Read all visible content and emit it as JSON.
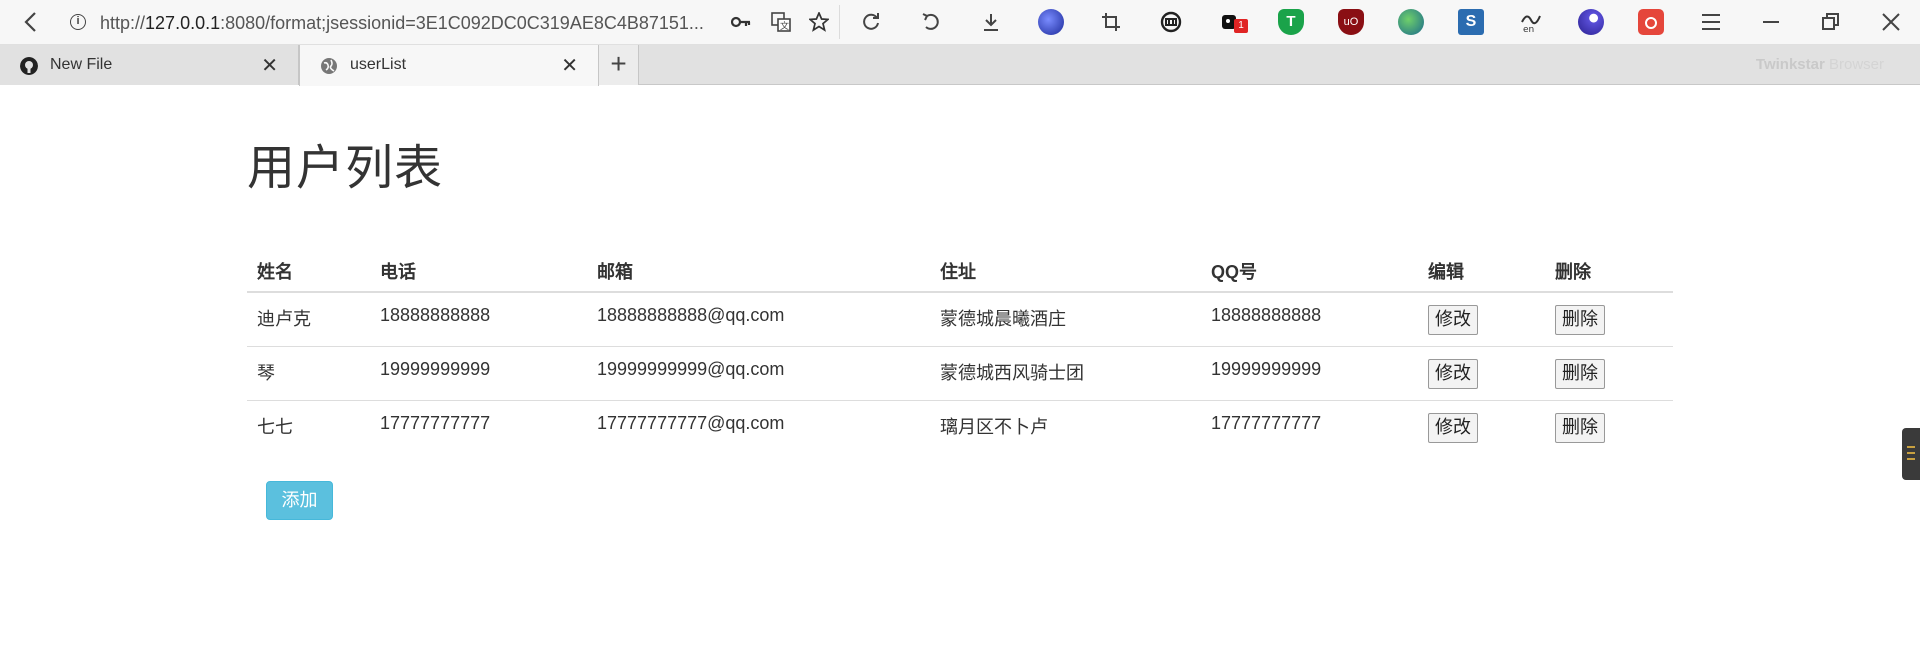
{
  "browser": {
    "url_prefix": "http://",
    "url_host": "127.0.0.1",
    "url_rest": ":8080/format;jsessionid=3E1C092DC0C319AE8C4B87151...",
    "extension_badge": "1",
    "brand_name_1": "Twinkstar",
    "brand_name_2": "Browser",
    "icons": [
      "back-icon",
      "info-icon",
      "key-icon",
      "translate-icon",
      "star-icon",
      "reload-icon",
      "undo-icon",
      "download-icon",
      "globe-extension-icon",
      "crop-icon",
      "link-icon",
      "puzzle-extension-icon",
      "shield-extension-icon",
      "ublock-icon",
      "earth-extension-icon",
      "s-extension-icon",
      "translate-en-icon",
      "orb-extension-icon",
      "camera-icon",
      "menu-icon",
      "minimize-icon",
      "restore-icon",
      "close-window-icon"
    ]
  },
  "tabs": [
    {
      "label": "New File",
      "icon": "github-icon",
      "active": false
    },
    {
      "label": "userList",
      "icon": "globe-icon",
      "active": true
    }
  ],
  "page": {
    "title": "用户列表",
    "columns": [
      "姓名",
      "电话",
      "邮箱",
      "住址",
      "QQ号",
      "编辑",
      "删除"
    ],
    "rows": [
      {
        "name": "迪卢克",
        "phone": "18888888888",
        "email": "18888888888@qq.com",
        "address": "蒙德城晨曦酒庄",
        "qq": "18888888888",
        "edit": "修改",
        "delete": "删除"
      },
      {
        "name": "琴",
        "phone": "19999999999",
        "email": "19999999999@qq.com",
        "address": "蒙德城西风骑士团",
        "qq": "19999999999",
        "edit": "修改",
        "delete": "删除"
      },
      {
        "name": "七七",
        "phone": "17777777777",
        "email": "17777777777@qq.com",
        "address": "璃月区不卜卢",
        "qq": "17777777777",
        "edit": "修改",
        "delete": "删除"
      }
    ],
    "add_label": "添加"
  },
  "colors": {
    "add_button": "#5bc0de",
    "badge": "#e02424"
  }
}
